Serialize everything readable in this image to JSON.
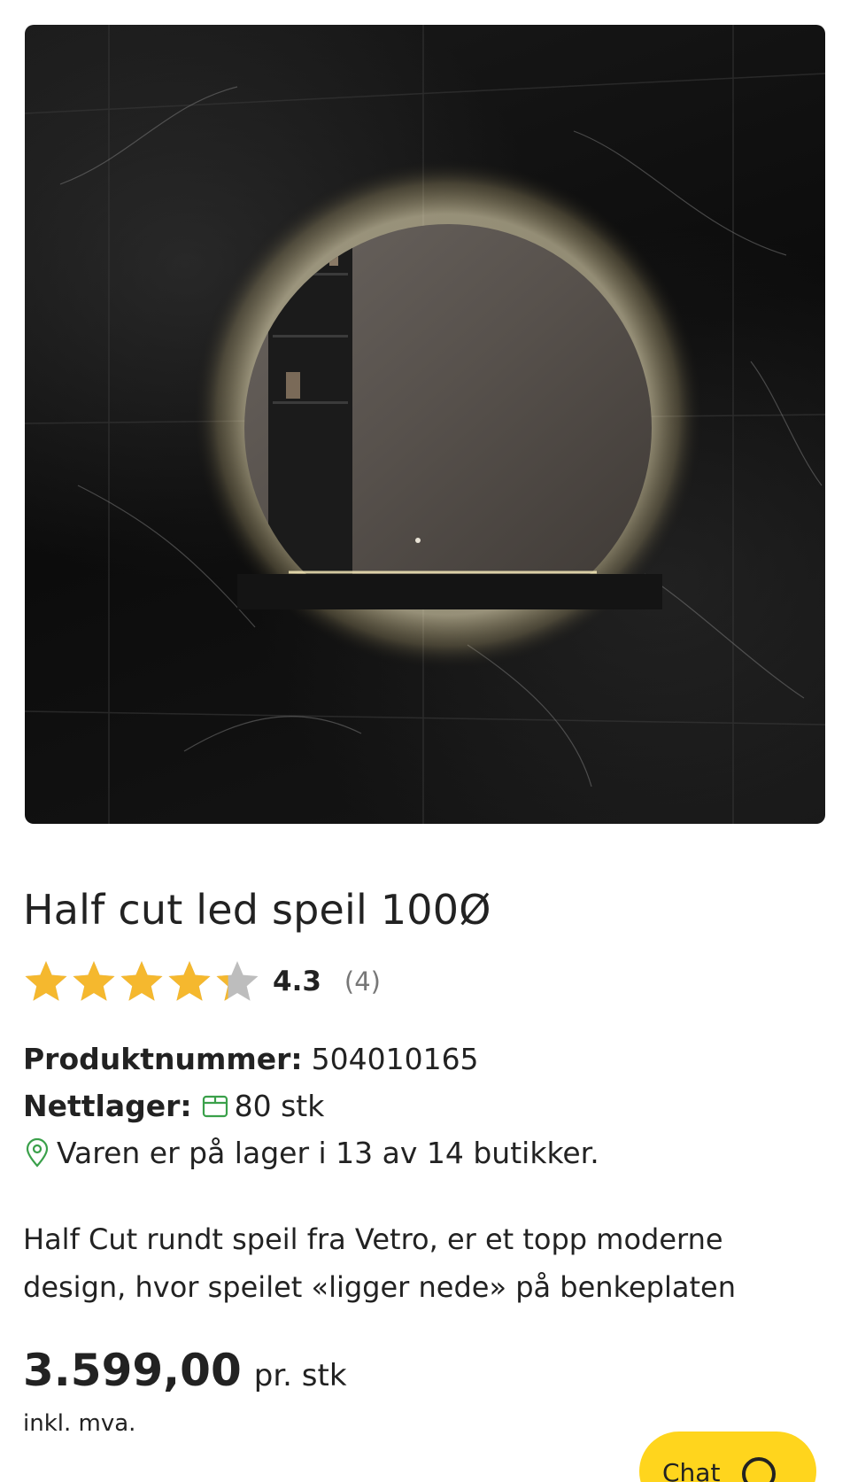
{
  "product": {
    "title": "Half cut led speil 100Ø",
    "rating": {
      "value": "4.3",
      "count": "(4)",
      "stars_out_of_5": 4.3
    },
    "sku_label": "Produktnummer:",
    "sku_value": "504010165",
    "stock_label": "Nettlager:",
    "stock_value": "80 stk",
    "store_availability": "Varen er på lager i 13 av 14 butikker.",
    "description": "Half Cut rundt speil fra Vetro, er et topp moderne design, hvor speilet «ligger nede» på benkeplaten",
    "price": "3.599,00",
    "price_unit": "pr. stk",
    "vat_note": "inkl. mva."
  },
  "chat": {
    "label": "Chat"
  },
  "colors": {
    "star": "#f5b82e",
    "star_empty": "#bdbdbd",
    "accent_green": "#3aa04a",
    "chat_yellow": "#ffd51d"
  },
  "icons": [
    "star-icon",
    "box-icon",
    "location-pin-icon",
    "chat-bubble-icon"
  ]
}
